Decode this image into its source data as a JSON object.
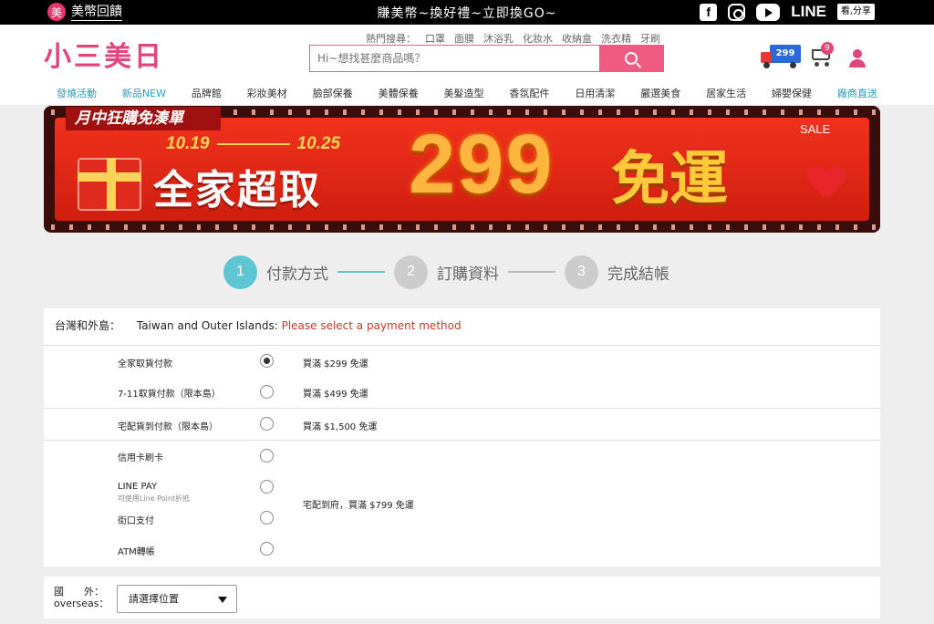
{
  "topbar": {
    "rebate_badge": "美",
    "rebate_label": "美幣回饋",
    "promo": "賺美幣~換好禮~立即換GO~",
    "social": [
      "facebook-icon",
      "instagram-icon",
      "youtube-icon"
    ],
    "line_label": "LINE",
    "share_label": "看,分享"
  },
  "header": {
    "logo": "小三美日",
    "hot_searches_label": "熱門搜尋：",
    "hot_searches": [
      "口罩",
      "面膜",
      "沐浴乳",
      "化妝水",
      "收納盒",
      "洗衣精",
      "牙刷"
    ],
    "search_placeholder": "Hi~想找甚麼商品嗎？",
    "truck_badge": "299",
    "cart_count": "9"
  },
  "nav": {
    "items": [
      "發燒活動",
      "新品NEW",
      "品牌館",
      "彩妝美材",
      "臉部保養",
      "美體保養",
      "美髮造型",
      "香氛配件",
      "日用清潔",
      "嚴選美食",
      "居家生活",
      "婦嬰保健",
      "廠商直送"
    ]
  },
  "banner": {
    "tagline": "月中狂購免湊單",
    "date_start": "10.19",
    "date_end": "10.25",
    "store": "全家超取",
    "amount": "299",
    "free_shipping": "免運",
    "sale": "SALE"
  },
  "steps": [
    {
      "num": "1",
      "label": "付款方式"
    },
    {
      "num": "2",
      "label": "訂購資料"
    },
    {
      "num": "3",
      "label": "完成結帳"
    }
  ],
  "payment": {
    "region_label": "台灣和外島：",
    "region_en": "Taiwan and Outer Islands:",
    "warning": "Please select a payment method",
    "options": [
      {
        "label": "全家取貨付款",
        "checked": true
      },
      {
        "label": "7-11取貨付款（限本島）",
        "checked": false
      },
      {
        "label": "宅配貨到付款（限本島）",
        "checked": false
      },
      {
        "label": "信用卡刷卡",
        "checked": false
      },
      {
        "label": "LINE PAY",
        "sub": "可使用Line Point折抵",
        "checked": false
      },
      {
        "label": "街口支付",
        "checked": false
      },
      {
        "label": "ATM轉帳",
        "checked": false
      }
    ],
    "conditions": [
      "買滿 $299 免運",
      "買滿 $499 免運",
      "買滿 $1,500 免運",
      "宅配到府，買滿 $799 免運"
    ]
  },
  "overseas": {
    "label_zh": "國　　外：",
    "label_en": "overseas：",
    "select_value": "請選擇位置"
  }
}
